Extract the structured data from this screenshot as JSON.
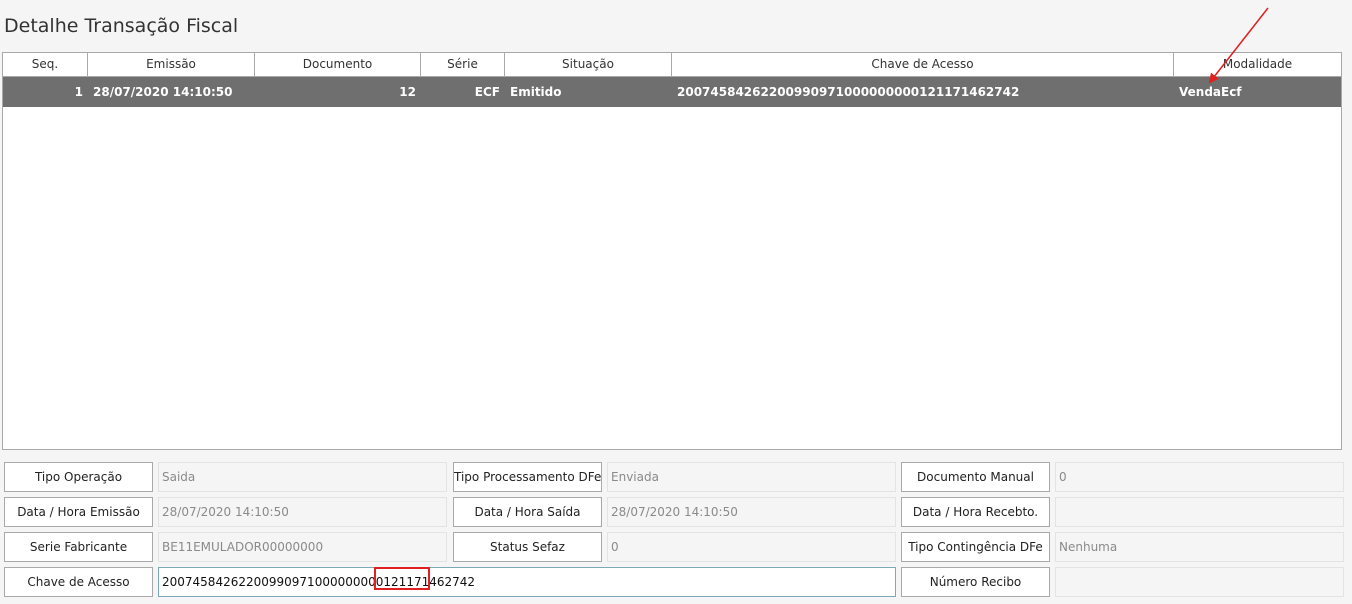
{
  "page": {
    "title": "Detalhe Transação Fiscal"
  },
  "grid": {
    "columns": [
      "Seq.",
      "Emissão",
      "Documento",
      "Série",
      "Situação",
      "Chave de Acesso",
      "Modalidade"
    ],
    "rows": [
      {
        "seq": "1",
        "emissao": "28/07/2020 14:10:50",
        "documento": "12",
        "serie": "ECF",
        "situacao": "Emitido",
        "chave": "20074584262200990971000000000121171462742",
        "modalidade": "VendaEcf"
      }
    ]
  },
  "form": {
    "tipo_operacao": {
      "label": "Tipo Operação",
      "value": "Saida"
    },
    "tipo_processamento": {
      "label": "Tipo Processamento DFe",
      "value": "Enviada"
    },
    "documento_manual": {
      "label": "Documento Manual",
      "value": "0"
    },
    "data_emissao": {
      "label": "Data / Hora Emissão",
      "value": "28/07/2020 14:10:50"
    },
    "data_saida": {
      "label": "Data / Hora Saída",
      "value": "28/07/2020 14:10:50"
    },
    "data_recebto": {
      "label": "Data / Hora Recebto.",
      "value": ""
    },
    "serie_fabricante": {
      "label": "Serie Fabricante",
      "value": "BE11EMULADOR00000000"
    },
    "status_sefaz": {
      "label": "Status Sefaz",
      "value": "0"
    },
    "tipo_contingencia": {
      "label": "Tipo Contingência DFe",
      "value": "Nenhuma"
    },
    "chave_acesso": {
      "label": "Chave de Acesso",
      "value": "20074584262200990971000000000121171462742"
    },
    "numero_recibo": {
      "label": "Número Recibo",
      "value": ""
    }
  },
  "annotation": {
    "color": "#e02020"
  }
}
